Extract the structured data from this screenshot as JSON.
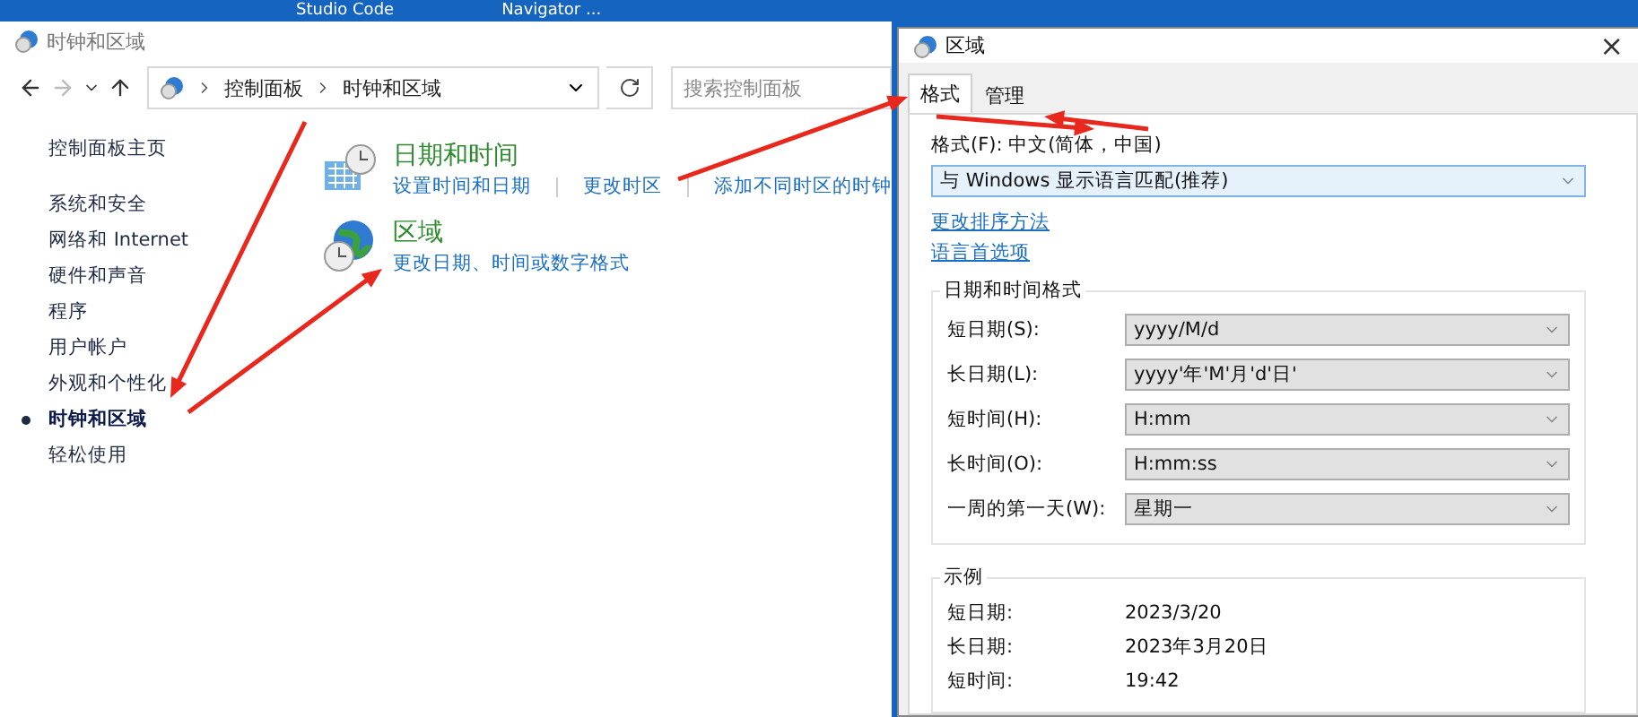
{
  "desktop": {
    "taskbar_items": [
      "Studio Code",
      "Navigator ..."
    ]
  },
  "control_panel": {
    "title": "时钟和区域",
    "breadcrumb": [
      "控制面板",
      "时钟和区域"
    ],
    "search": {
      "placeholder": "搜索控制面板"
    },
    "sidebar": {
      "home": "控制面板主页",
      "items": [
        {
          "label": "系统和安全",
          "selected": false
        },
        {
          "label": "网络和 Internet",
          "selected": false
        },
        {
          "label": "硬件和声音",
          "selected": false
        },
        {
          "label": "程序",
          "selected": false
        },
        {
          "label": "用户帐户",
          "selected": false
        },
        {
          "label": "外观和个性化",
          "selected": false
        },
        {
          "label": "时钟和区域",
          "selected": true
        },
        {
          "label": "轻松使用",
          "selected": false
        }
      ]
    },
    "categories": [
      {
        "kind": "datetime",
        "title": "日期和时间",
        "links": [
          "设置时间和日期",
          "更改时区",
          "添加不同时区的时钟"
        ]
      },
      {
        "kind": "region",
        "title": "区域",
        "links": [
          "更改日期、时间或数字格式"
        ]
      }
    ]
  },
  "dialog": {
    "title": "区域",
    "close": "×",
    "tabs": [
      {
        "label": "格式",
        "selected": true
      },
      {
        "label": "管理",
        "selected": false
      }
    ],
    "format_label": "格式(F): 中文(简体，中国)",
    "format_value": "与 Windows 显示语言匹配(推荐)",
    "links": [
      "更改排序方法",
      "语言首选项"
    ],
    "formats_group": {
      "title": "日期和时间格式",
      "fields": [
        {
          "label": "短日期(S):",
          "value": "yyyy/M/d"
        },
        {
          "label": "长日期(L):",
          "value": "yyyy'年'M'月'd'日'"
        },
        {
          "label": "短时间(H):",
          "value": "H:mm"
        },
        {
          "label": "长时间(O):",
          "value": "H:mm:ss"
        },
        {
          "label": "一周的第一天(W):",
          "value": "星期一"
        }
      ]
    },
    "example_group": {
      "title": "示例",
      "rows": [
        {
          "label": "短日期:",
          "value": "2023/3/20"
        },
        {
          "label": "长日期:",
          "value": "2023年3月20日"
        },
        {
          "label": "短时间:",
          "value": "19:42"
        }
      ]
    }
  }
}
